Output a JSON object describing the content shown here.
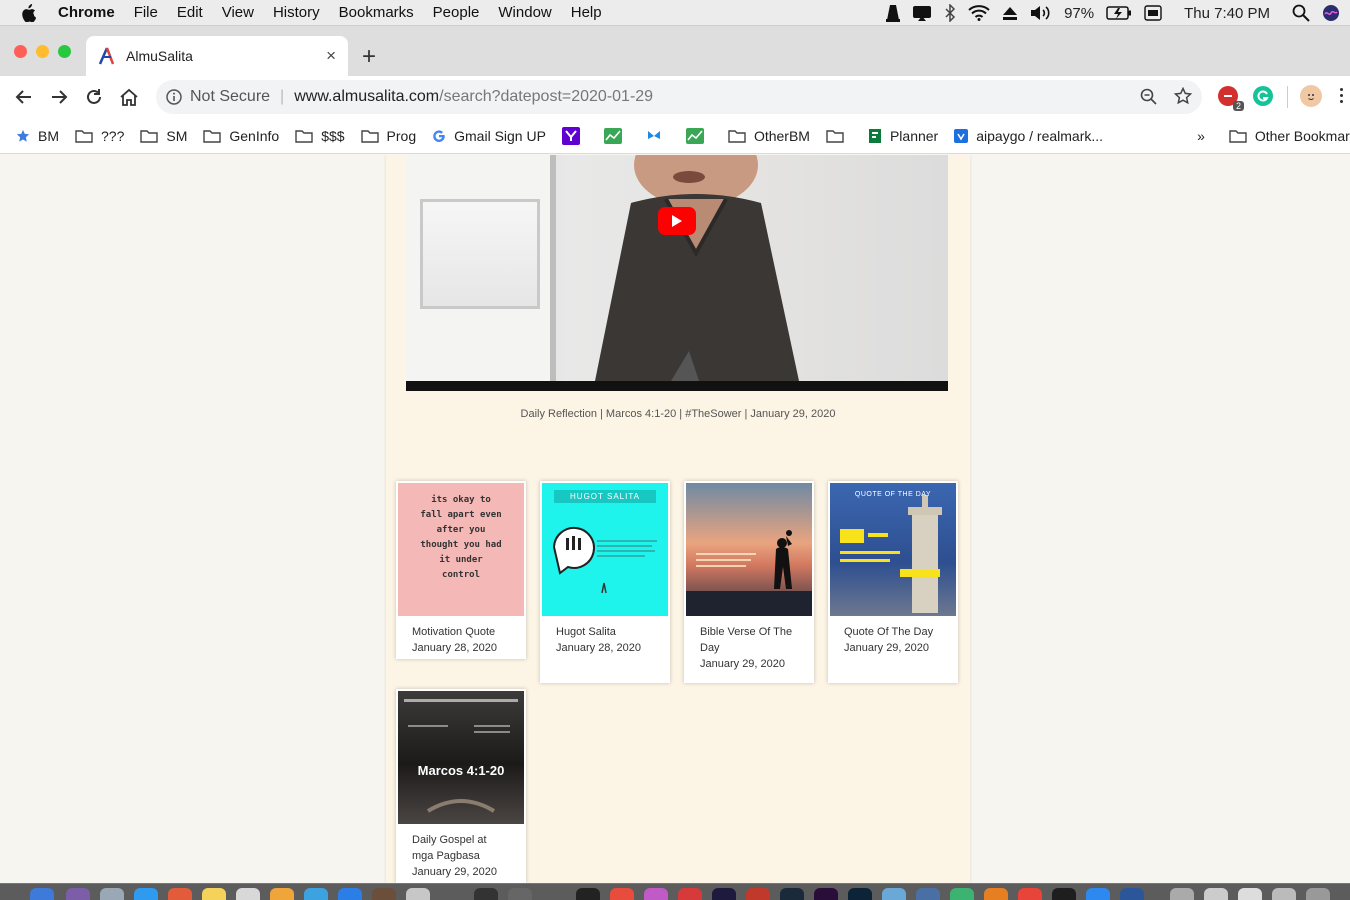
{
  "menubar": {
    "app_name": "Chrome",
    "items": [
      "File",
      "Edit",
      "View",
      "History",
      "Bookmarks",
      "People",
      "Window",
      "Help"
    ],
    "battery": "97%",
    "clock": "Thu 7:40 PM"
  },
  "tab": {
    "title": "AlmuSalita",
    "close_label": "×",
    "new_tab_label": "+"
  },
  "toolbar": {
    "security_label": "Not Secure",
    "url_host": "www.almusalita.com",
    "url_path": "/search?datepost=2020-01-29",
    "ext_badge": "2"
  },
  "bookmarks": {
    "items": [
      "BM",
      "???",
      "SM",
      "GenInfo",
      "$$$",
      "Prog",
      "Gmail Sign UP",
      "OtherBM",
      "Planner",
      "aipaygo / realmark..."
    ],
    "overflow_label": "»",
    "other_label": "Other Bookmarks"
  },
  "video": {
    "caption": "Daily Reflection | Marcos 4:1-20 | #TheSower | January 29, 2020"
  },
  "cards": [
    {
      "title": "Motivation Quote",
      "date": "January 28, 2020",
      "thumb_text": "its okay to fall apart even after you thought you had it under control"
    },
    {
      "title": "Hugot Salita",
      "date": "January 28, 2020",
      "thumb_text": "HUGOT SALITA"
    },
    {
      "title": "Bible Verse Of The Day",
      "date": "January 29, 2020",
      "thumb_text": ""
    },
    {
      "title": "Quote Of The Day",
      "date": "January 29, 2020",
      "thumb_text": "QUOTE OF THE DAY"
    },
    {
      "title": "Daily Gospel at mga Pagbasa",
      "date": "January 29, 2020",
      "thumb_text": "Marcos 4:1-20"
    }
  ],
  "colors": {
    "page_bg": "#f7f5ef",
    "column_bg": "#fcf4e4",
    "youtube_red": "#ff0000"
  }
}
